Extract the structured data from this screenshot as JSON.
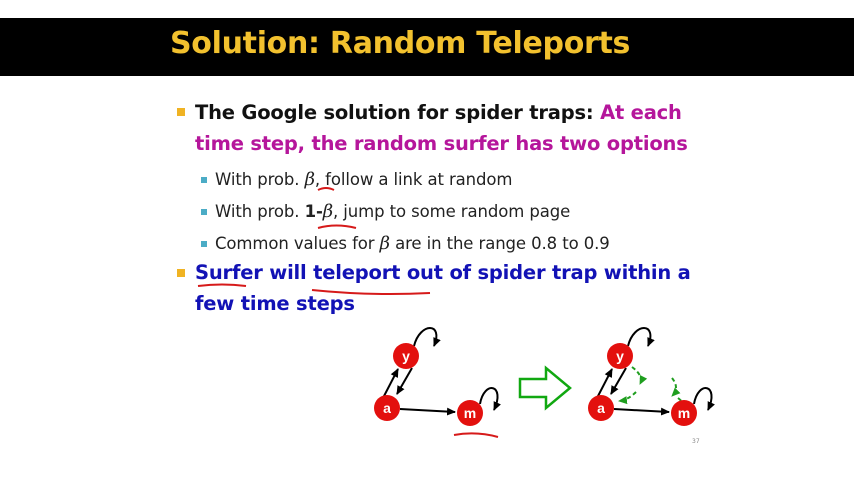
{
  "title": "Solution: Random Teleports",
  "bullets": {
    "b1_line1_black": "The Google solution for spider traps: ",
    "b1_line1_magenta": "At each",
    "b1_line2_magenta": "time step, the random surfer has two options",
    "sub1_pre": "With prob. ",
    "sub1_beta": "β",
    "sub1_post": ", follow a link at random",
    "sub2_pre": "With prob. ",
    "sub2_one": "1-",
    "sub2_beta": "β",
    "sub2_post": ", jump to some random page",
    "sub3_pre": "Common values for ",
    "sub3_beta": "β",
    "sub3_post": "  are in the range 0.8 to 0.9",
    "b2_line1": "Surfer will teleport out of spider trap within a",
    "b2_line2": "few time steps"
  },
  "diagram_left": {
    "nodes": [
      "y",
      "a",
      "m"
    ]
  },
  "diagram_right": {
    "nodes": [
      "y",
      "a",
      "m"
    ]
  },
  "page_number": "37",
  "colors": {
    "title": "#f2c12e",
    "title_bar": "#000000",
    "magenta": "#b5169b",
    "blue": "#1212b5",
    "node_fill": "#e3100e",
    "arrow_green": "#11a811",
    "teleport_green": "#1f9e1f",
    "annotation_red": "#d61a1a",
    "bullet": "#f0b323",
    "sub_bullet": "#4bacc6"
  },
  "icons": [
    "right-outline-arrow-icon"
  ]
}
